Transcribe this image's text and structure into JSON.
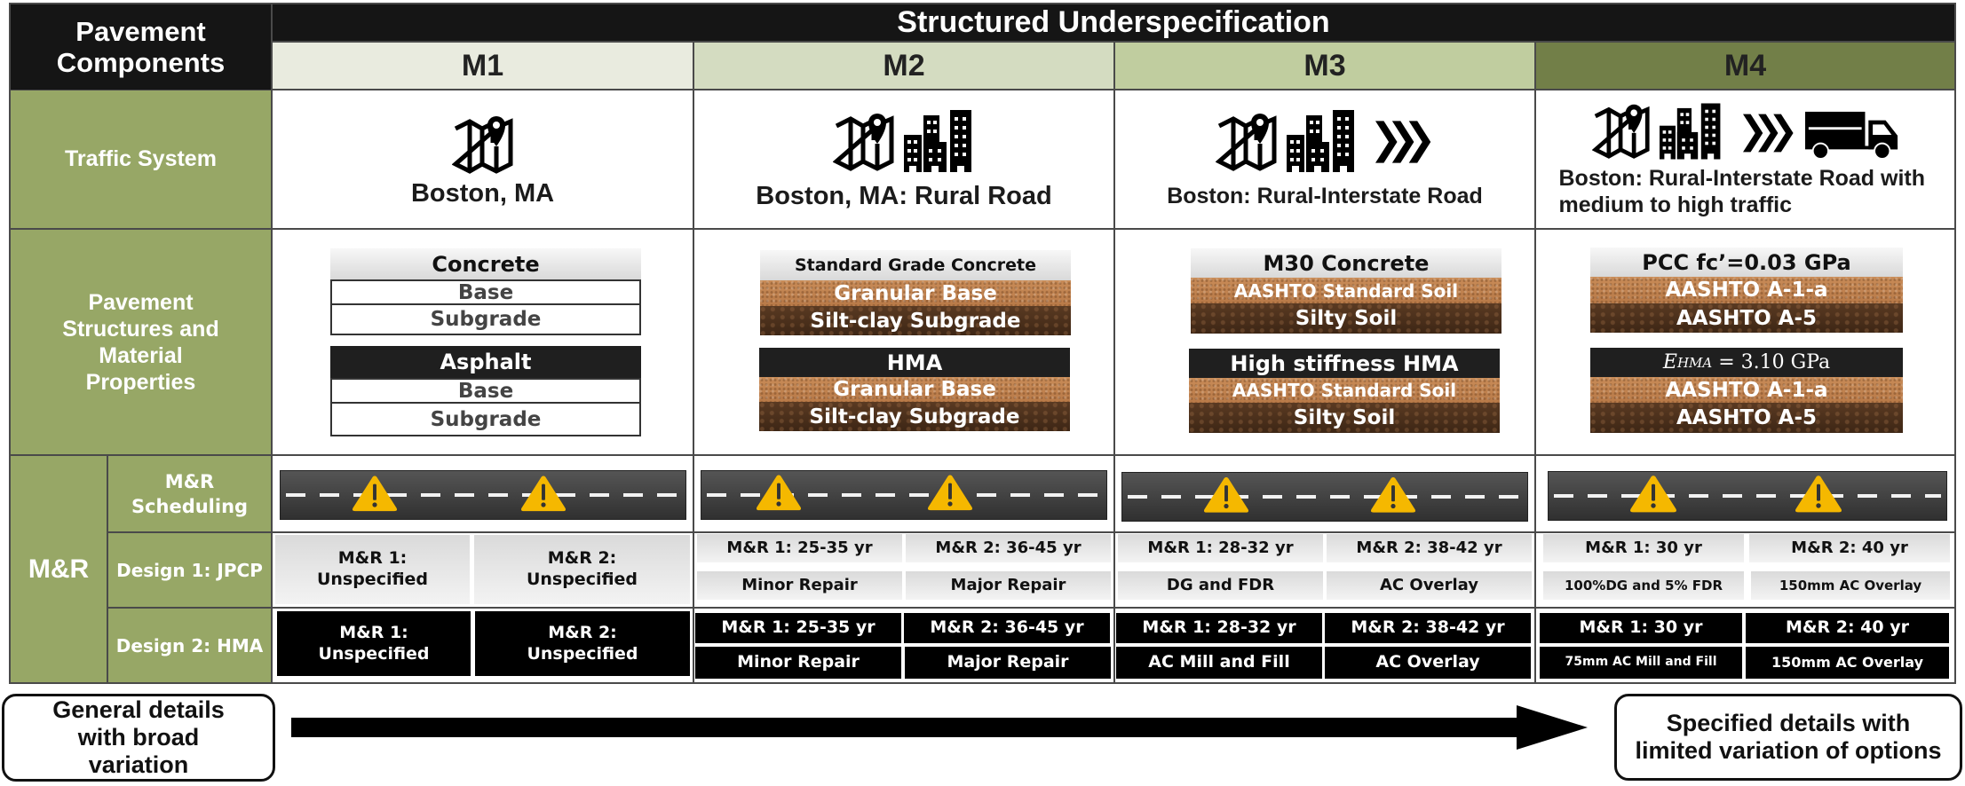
{
  "header": {
    "row_label": "Pavement Components",
    "title": "Structured Underspecification",
    "levels": [
      {
        "id": "M1",
        "color": "#e9ebdf"
      },
      {
        "id": "M2",
        "color": "#d4dcc1"
      },
      {
        "id": "M3",
        "color": "#c0cd9f"
      },
      {
        "id": "M4",
        "color": "#727f48"
      }
    ]
  },
  "rows": {
    "traffic_system": "Traffic System",
    "pavement_structures": "Pavement Structures and Material Properties",
    "mr_group": "M&R",
    "mr_scheduling": "M&R Scheduling",
    "design1": "Design 1: JPCP",
    "design2": "Design 2: HMA"
  },
  "traffic": [
    {
      "label": "Boston, MA",
      "icons": [
        "map-pin-icon"
      ]
    },
    {
      "label": "Boston, MA: Rural Road",
      "icons": [
        "map-pin-icon",
        "buildings-icon"
      ]
    },
    {
      "label": "Boston: Rural-Interstate Road",
      "icons": [
        "map-pin-icon",
        "buildings-icon",
        "chevrons-right-icon"
      ]
    },
    {
      "label": "Boston: Rural-Interstate Road with medium to high traffic",
      "icons": [
        "map-pin-icon",
        "buildings-icon",
        "chevrons-right-icon",
        "truck-icon"
      ]
    }
  ],
  "structures": [
    {
      "concrete": [
        "Concrete",
        "Base",
        "Subgrade"
      ],
      "asphalt": [
        "Asphalt",
        "Base",
        "Subgrade"
      ]
    },
    {
      "concrete": [
        "Standard Grade Concrete",
        "Granular Base",
        "Silt-clay  Subgrade"
      ],
      "asphalt": [
        "HMA",
        "Granular Base",
        "Silt-clay Subgrade"
      ]
    },
    {
      "concrete": [
        "M30 Concrete",
        "AASHTO Standard Soil",
        "Silty Soil"
      ],
      "asphalt": [
        "High stiffness HMA",
        "AASHTO Standard Soil",
        "Silty Soil"
      ]
    },
    {
      "concrete": [
        "PCC fc’=0.03 GPa",
        "AASHTO A-1-a",
        "AASHTO A-5"
      ],
      "asphalt": [
        "E_HMA = 3.10 GPa",
        "AASHTO A-1-a",
        "AASHTO A-5"
      ],
      "asphalt_top_math": {
        "symbol": "E",
        "subscript": "HMA",
        "rest": " = 3.10 GPa"
      }
    }
  ],
  "scheduling_icon": "warning-icon",
  "design1": [
    {
      "mr1": "M&R 1: Unspecified",
      "mr1_line1": "M&R 1:",
      "mr1_line2": "Unspecified",
      "mr2_line1": "M&R 2:",
      "mr2_line2": "Unspecified"
    },
    {
      "mr1_time": "M&R 1: 25-35 yr",
      "mr2_time": "M&R 2: 36-45 yr",
      "mr1_action": "Minor Repair",
      "mr2_action": "Major Repair"
    },
    {
      "mr1_time": "M&R 1: 28-32 yr",
      "mr2_time": "M&R 2: 38-42 yr",
      "mr1_action": "DG and FDR",
      "mr2_action": "AC Overlay"
    },
    {
      "mr1_time": "M&R 1: 30 yr",
      "mr2_time": "M&R 2: 40 yr",
      "mr1_action": "100%DG and 5% FDR",
      "mr2_action": "150mm AC Overlay"
    }
  ],
  "design2": [
    {
      "mr1_line1": "M&R 1:",
      "mr1_line2": "Unspecified",
      "mr2_line1": "M&R 2:",
      "mr2_line2": "Unspecified"
    },
    {
      "mr1_time": "M&R 1: 25-35 yr",
      "mr2_time": "M&R 2: 36-45 yr",
      "mr1_action": "Minor Repair",
      "mr2_action": "Major Repair"
    },
    {
      "mr1_time": "M&R 1: 28-32 yr",
      "mr2_time": "M&R 2: 38-42 yr",
      "mr1_action": "AC Mill and Fill",
      "mr2_action": "AC Overlay"
    },
    {
      "mr1_time": "M&R 1: 30 yr",
      "mr2_time": "M&R 2: 40 yr",
      "mr1_action": "75mm AC Mill and Fill",
      "mr2_action": "150mm AC Overlay"
    }
  ],
  "footer": {
    "left": "General details with broad variation",
    "right": "Specified details with limited variation of options"
  }
}
